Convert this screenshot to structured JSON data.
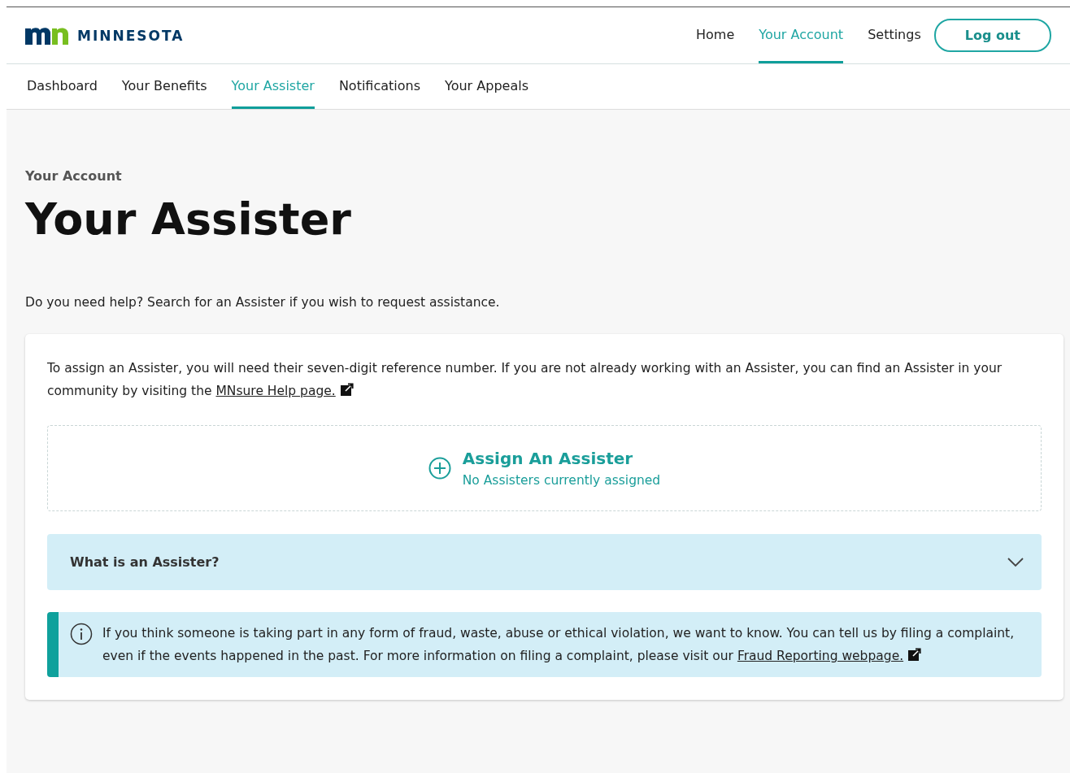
{
  "header": {
    "logo_text": "MINNESOTA",
    "nav": [
      {
        "label": "Home",
        "selected": false
      },
      {
        "label": "Your Account",
        "selected": true
      },
      {
        "label": "Settings",
        "selected": false
      }
    ],
    "logout": "Log out"
  },
  "subnav": [
    {
      "label": "Dashboard",
      "selected": false
    },
    {
      "label": "Your Benefits",
      "selected": false
    },
    {
      "label": "Your Assister",
      "selected": true
    },
    {
      "label": "Notifications",
      "selected": false
    },
    {
      "label": "Your Appeals",
      "selected": false
    }
  ],
  "breadcrumb": "Your Account",
  "title": "Your Assister",
  "intro": "Do you need help? Search for an Assister if you wish to request assistance.",
  "card": {
    "text": "To assign an Assister, you will need their seven-digit reference number. If you are not already working with an Assister, you can find an Assister in your community by visiting the",
    "link": "MNsure Help page.",
    "assign": {
      "title": "Assign An Assister",
      "subtitle": "No Assisters currently assigned"
    },
    "accordion": {
      "label": "What is an Assister?",
      "expanded": false
    },
    "notice": {
      "text": "If you think someone is taking part in any form of fraud, waste, abuse or ethical violation, we want to know. You can tell us by filing a complaint, even if the events happened in the past. For more information on filing a complaint, please visit our",
      "link": "Fraud Reporting webpage."
    }
  }
}
